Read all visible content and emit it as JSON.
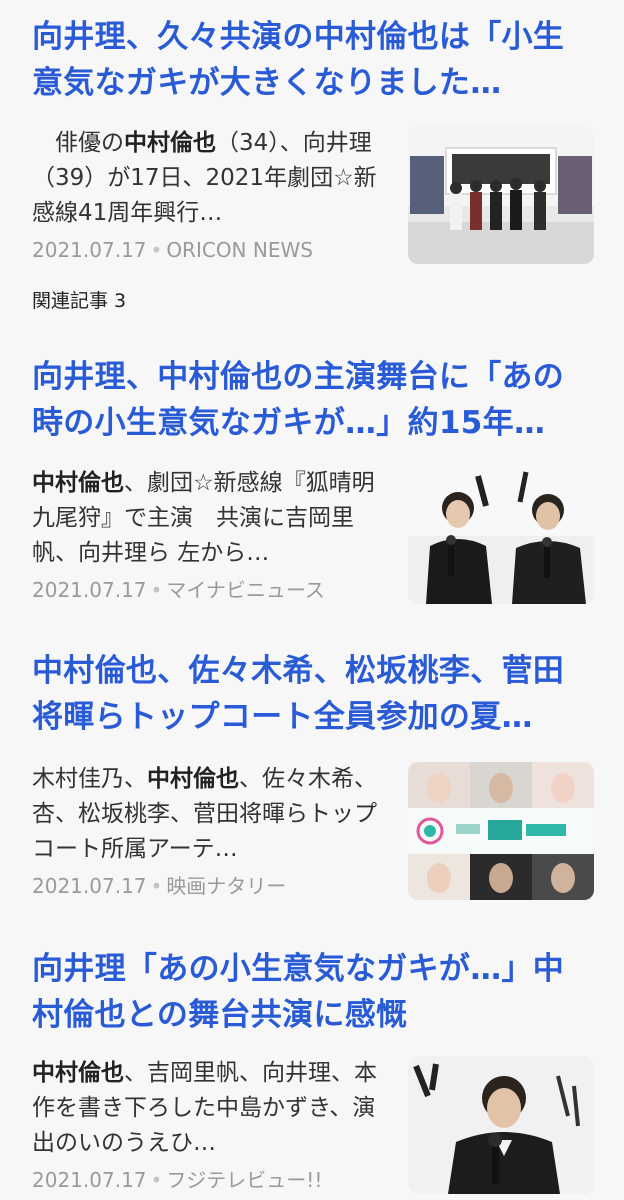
{
  "articles": [
    {
      "title": "向井理、久々共演の中村倫也は「小生意気なガキが大きくなりました…",
      "snippet_pre": "　俳優の",
      "snippet_bold": "中村倫也",
      "snippet_post": "（34）、向井理（39）が17日、2021年劇団☆新感線41周年興行…",
      "date": "2021.07.17",
      "source": "ORICON NEWS",
      "related": "関連記事 3"
    },
    {
      "title": "向井理、中村倫也の主演舞台に「あの時の小生意気なガキが…」約15年…",
      "snippet_pre": "",
      "snippet_bold": "中村倫也",
      "snippet_post": "、劇団☆新感線『狐晴明九尾狩』で主演　共演に吉岡里帆、向井理ら 左から…",
      "date": "2021.07.17",
      "source": "マイナビニュース"
    },
    {
      "title": "中村倫也、佐々木希、松坂桃李、菅田将暉らトップコート全員参加の夏…",
      "snippet_pre": "木村佳乃、",
      "snippet_bold": "中村倫也",
      "snippet_post": "、佐々木希、杏、松坂桃李、菅田将暉らトップコート所属アーテ…",
      "date": "2021.07.17",
      "source": "映画ナタリー"
    },
    {
      "title": "向井理「あの小生意気なガキが…」中村倫也との舞台共演に感慨",
      "snippet_pre": "",
      "snippet_bold": "中村倫也",
      "snippet_post": "、吉岡里帆、向井理、本作を書き下ろした中島かずき、演出のいのうえひ…",
      "date": "2021.07.17",
      "source": "フジテレビュー!!"
    }
  ],
  "colors": {
    "title": "#2a5bd7",
    "meta": "#9a9a9a",
    "background": "#f7f7f8"
  },
  "icons": {
    "thumb1": "stage-group-photo",
    "thumb2": "two-actors-microphones-photo",
    "thumb3": "topcoat-natsumatsuri-collage",
    "thumb4": "actor-microphone-photo"
  }
}
